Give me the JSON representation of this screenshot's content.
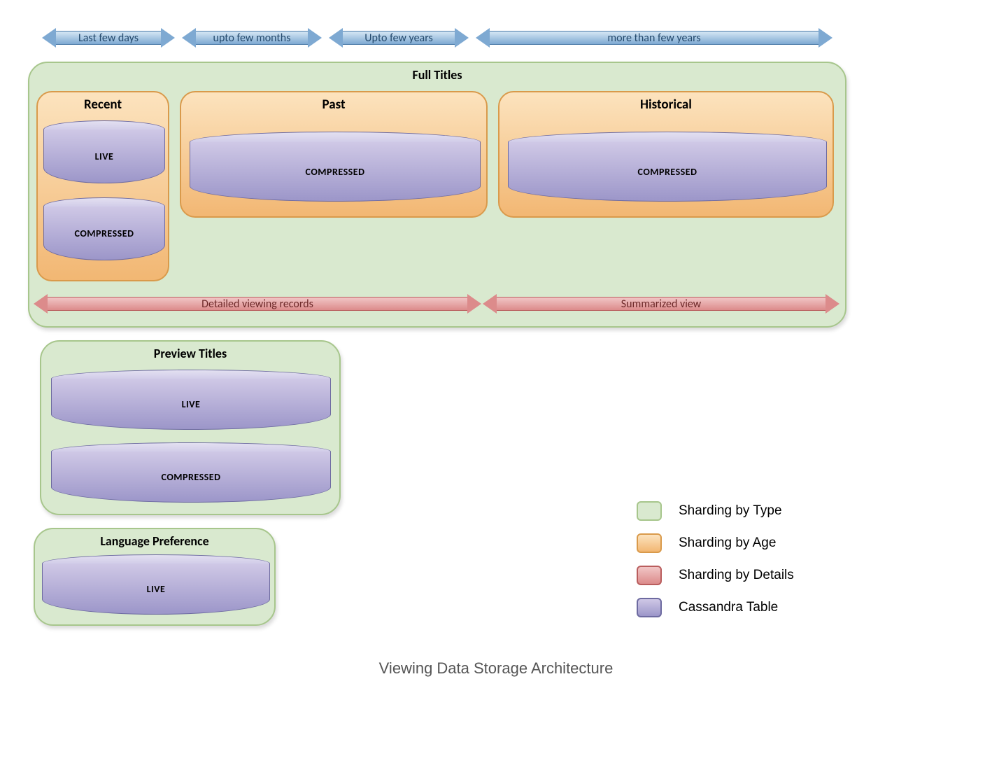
{
  "timeline": [
    {
      "label": "Last few days"
    },
    {
      "label": "upto few months"
    },
    {
      "label": "Upto few years"
    },
    {
      "label": "more than few years"
    }
  ],
  "full_titles": {
    "title": "Full Titles",
    "ages": {
      "recent": {
        "title": "Recent",
        "cylinders": [
          "LIVE",
          "COMPRESSED"
        ]
      },
      "past": {
        "title": "Past",
        "cylinders": [
          "COMPRESSED"
        ]
      },
      "historical": {
        "title": "Historical",
        "cylinders": [
          "COMPRESSED"
        ]
      }
    },
    "detail_arrows": {
      "detailed": "Detailed viewing records",
      "summarized": "Summarized view"
    }
  },
  "preview_titles": {
    "title": "Preview Titles",
    "cylinders": [
      "LIVE",
      "COMPRESSED"
    ]
  },
  "language_pref": {
    "title": "Language Preference",
    "cylinders": [
      "LIVE"
    ]
  },
  "legend": [
    {
      "swatch": "green",
      "label": "Sharding by Type"
    },
    {
      "swatch": "orange",
      "label": "Sharding by Age"
    },
    {
      "swatch": "pink",
      "label": "Sharding by Details"
    },
    {
      "swatch": "purple",
      "label": "Cassandra Table"
    }
  ],
  "caption": "Viewing Data Storage Architecture",
  "colors": {
    "type_bg": "#d9e9cf",
    "age_bg_top": "#fce3be",
    "age_bg_bottom": "#f2b773",
    "cyl_bg_top": "#cfc8e6",
    "cyl_bg_bottom": "#9c96c9",
    "arrow_blue_top": "#d6e7f5",
    "arrow_blue_bottom": "#7ea9d2",
    "arrow_pink_top": "#f1c6c6",
    "arrow_pink_bottom": "#dc8b8b"
  }
}
